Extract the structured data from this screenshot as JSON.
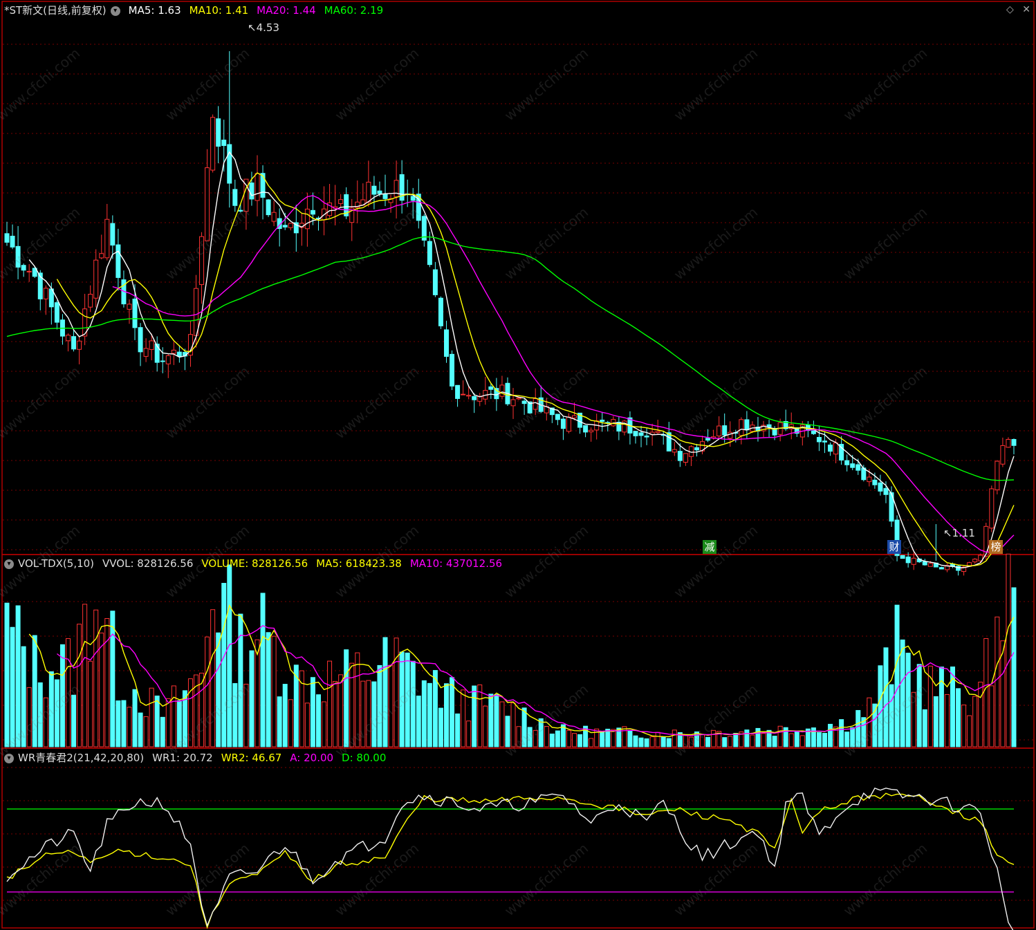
{
  "main_panel": {
    "title": "*ST新文(日线,前复权)",
    "ma_labels": [
      {
        "text": "MA5: 1.63",
        "color": "#ffffff"
      },
      {
        "text": "MA10: 1.41",
        "color": "#ffff00"
      },
      {
        "text": "MA20: 1.44",
        "color": "#ff00ff"
      },
      {
        "text": "MA60: 2.19",
        "color": "#00ff00"
      }
    ],
    "high_marker": "4.53",
    "low_marker": "1.11",
    "signals": [
      {
        "text": "减",
        "bg": "#1a8a1a",
        "x": 1026
      },
      {
        "text": "财",
        "bg": "#1a4aa8",
        "x": 1293
      },
      {
        "text": "榜",
        "bg": "#b06a20",
        "x": 1440
      }
    ]
  },
  "vol_panel": {
    "title": "VOL-TDX(5,10)",
    "labels": [
      {
        "text": "VVOL: 828126.56",
        "color": "#dddddd"
      },
      {
        "text": "VOLUME: 828126.56",
        "color": "#ffff00"
      },
      {
        "text": "MA5: 618423.38",
        "color": "#ffff00"
      },
      {
        "text": "MA10: 437012.56",
        "color": "#ff00ff"
      }
    ]
  },
  "wr_panel": {
    "title": "WR青春君2(21,42,20,80)",
    "labels": [
      {
        "text": "WR1: 20.72",
        "color": "#dddddd"
      },
      {
        "text": "WR2: 46.67",
        "color": "#ffff00"
      },
      {
        "text": "A: 20.00",
        "color": "#ff00ff"
      },
      {
        "text": "D: 80.00",
        "color": "#00ff00"
      }
    ]
  },
  "watermark": "www.cfchi.com",
  "colors": {
    "up": "#ff3232",
    "down": "#54ffff",
    "ma5": "#ffffff",
    "ma10": "#ffff00",
    "ma20": "#ff00ff",
    "ma60": "#00ff00",
    "grid": "#7a0000",
    "border": "#b00000"
  },
  "chart_data": [
    {
      "type": "candlestick",
      "title": "*ST新文(日线,前复权)",
      "ylim": [
        1.0,
        4.7
      ],
      "max_price": 4.53,
      "min_price": 1.11,
      "series": [
        {
          "name": "MA5",
          "value": 1.63
        },
        {
          "name": "MA10",
          "value": 1.41
        },
        {
          "name": "MA20",
          "value": 1.44
        },
        {
          "name": "MA60",
          "value": 2.19
        }
      ],
      "waypoints": [
        [
          0,
          3.15
        ],
        [
          5,
          2.9
        ],
        [
          12,
          2.35
        ],
        [
          18,
          3.3
        ],
        [
          23,
          2.45
        ],
        [
          28,
          2.3
        ],
        [
          33,
          2.4
        ],
        [
          37,
          4.1
        ],
        [
          41,
          3.45
        ],
        [
          45,
          3.55
        ],
        [
          50,
          3.2
        ],
        [
          55,
          3.45
        ],
        [
          60,
          3.35
        ],
        [
          65,
          3.5
        ],
        [
          72,
          3.55
        ],
        [
          76,
          2.9
        ],
        [
          80,
          2.1
        ],
        [
          84,
          2.05
        ],
        [
          90,
          2.05
        ],
        [
          100,
          1.85
        ],
        [
          115,
          1.8
        ],
        [
          121,
          1.62
        ],
        [
          126,
          1.75
        ],
        [
          132,
          1.85
        ],
        [
          141,
          1.8
        ],
        [
          147,
          1.72
        ],
        [
          153,
          1.52
        ],
        [
          158,
          1.32
        ],
        [
          160,
          0.88
        ],
        [
          163,
          0.84
        ],
        [
          167,
          0.79
        ],
        [
          171,
          0.78
        ],
        [
          175,
          0.86
        ],
        [
          178,
          1.55
        ],
        [
          180,
          1.73
        ]
      ]
    },
    {
      "type": "bar",
      "title": "VOL-TDX(5,10)",
      "series": [
        {
          "name": "VOLUME",
          "value": 828126.56
        },
        {
          "name": "MA5",
          "value": 618423.38
        },
        {
          "name": "MA10",
          "value": 437012.56
        }
      ],
      "waypoints": [
        [
          0,
          620000
        ],
        [
          5,
          430000
        ],
        [
          12,
          420000
        ],
        [
          16,
          840000
        ],
        [
          20,
          380000
        ],
        [
          28,
          170000
        ],
        [
          35,
          380000
        ],
        [
          37,
          880000
        ],
        [
          42,
          520000
        ],
        [
          45,
          620000
        ],
        [
          52,
          350000
        ],
        [
          60,
          360000
        ],
        [
          70,
          440000
        ],
        [
          80,
          260000
        ],
        [
          90,
          200000
        ],
        [
          100,
          80000
        ],
        [
          120,
          70000
        ],
        [
          140,
          90000
        ],
        [
          150,
          120000
        ],
        [
          155,
          200000
        ],
        [
          160,
          520000
        ],
        [
          165,
          330000
        ],
        [
          175,
          260000
        ],
        [
          178,
          650000
        ],
        [
          180,
          828126
        ]
      ]
    },
    {
      "type": "line",
      "title": "WR青春君2(21,42,20,80)",
      "ylim": [
        -5,
        115
      ],
      "series": [
        {
          "name": "WR1",
          "value": 20.72,
          "waypoints": [
            [
              0,
              32
            ],
            [
              8,
              55
            ],
            [
              12,
              62
            ],
            [
              15,
              35
            ],
            [
              18,
              68
            ],
            [
              23,
              85
            ],
            [
              28,
              85
            ],
            [
              33,
              55
            ],
            [
              36,
              -8
            ],
            [
              40,
              30
            ],
            [
              45,
              35
            ],
            [
              50,
              55
            ],
            [
              55,
              30
            ],
            [
              60,
              45
            ],
            [
              68,
              60
            ],
            [
              71,
              85
            ],
            [
              75,
              90
            ],
            [
              85,
              80
            ],
            [
              95,
              85
            ],
            [
              100,
              90
            ],
            [
              105,
              70
            ],
            [
              110,
              85
            ],
            [
              115,
              70
            ],
            [
              118,
              85
            ],
            [
              122,
              60
            ],
            [
              125,
              45
            ],
            [
              130,
              55
            ],
            [
              135,
              65
            ],
            [
              138,
              35
            ],
            [
              140,
              85
            ],
            [
              143,
              88
            ],
            [
              146,
              60
            ],
            [
              150,
              80
            ],
            [
              155,
              92
            ],
            [
              165,
              88
            ],
            [
              175,
              78
            ],
            [
              178,
              35
            ],
            [
              180,
              -5
            ]
          ]
        },
        {
          "name": "WR2",
          "value": 46.67,
          "waypoints": [
            [
              0,
              30
            ],
            [
              8,
              48
            ],
            [
              12,
              48
            ],
            [
              16,
              42
            ],
            [
              20,
              50
            ],
            [
              28,
              45
            ],
            [
              33,
              40
            ],
            [
              36,
              -5
            ],
            [
              40,
              28
            ],
            [
              45,
              32
            ],
            [
              50,
              48
            ],
            [
              55,
              28
            ],
            [
              60,
              40
            ],
            [
              68,
              45
            ],
            [
              72,
              72
            ],
            [
              75,
              88
            ],
            [
              85,
              85
            ],
            [
              95,
              88
            ],
            [
              100,
              88
            ],
            [
              110,
              80
            ],
            [
              115,
              75
            ],
            [
              120,
              80
            ],
            [
              125,
              75
            ],
            [
              130,
              72
            ],
            [
              135,
              62
            ],
            [
              138,
              50
            ],
            [
              141,
              85
            ],
            [
              143,
              65
            ],
            [
              147,
              80
            ],
            [
              155,
              90
            ],
            [
              165,
              88
            ],
            [
              175,
              70
            ],
            [
              178,
              48
            ],
            [
              180,
              40
            ]
          ]
        }
      ],
      "reference_lines": [
        {
          "name": "A",
          "value": 20
        },
        {
          "name": "D",
          "value": 80
        }
      ]
    }
  ]
}
